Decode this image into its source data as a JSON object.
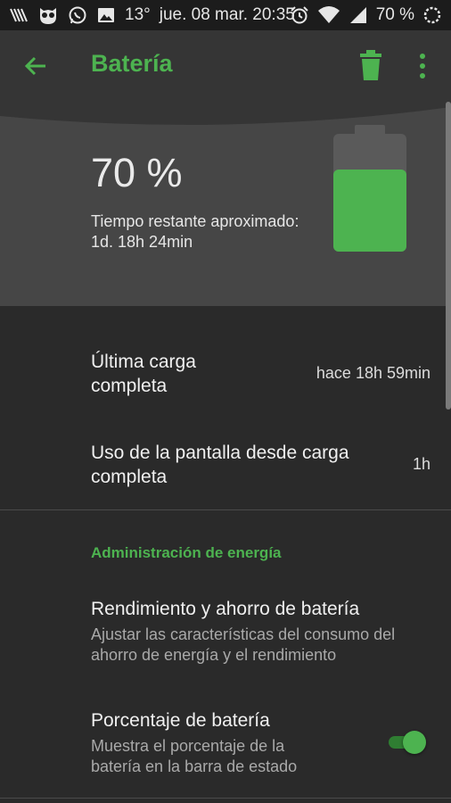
{
  "status_bar": {
    "left_icons": [
      "signal-slashes-icon",
      "owl-icon",
      "whatsapp-icon",
      "image-icon"
    ],
    "weather": "13°",
    "date_time": "jue. 08 mar. 20:35",
    "right_icons": [
      "alarm-icon",
      "wifi-icon",
      "cell-signal-icon"
    ],
    "battery_percent": "70 %"
  },
  "toolbar": {
    "title": "Batería",
    "accent_color": "#4db350"
  },
  "hero": {
    "percent": "70 %",
    "remaining_label": "Tiempo restante aproximado:",
    "remaining_value": "1d. 18h 24min",
    "battery_level": 0.7
  },
  "rows": [
    {
      "title_line1": "Última carga",
      "title_line2": "completa",
      "value": "hace 18h 59min"
    },
    {
      "title_line1": "Uso de la pantalla desde carga",
      "title_line2": "completa",
      "value": "1h"
    }
  ],
  "section_header": "Administración de energía",
  "settings": [
    {
      "title": "Rendimiento y ahorro de batería",
      "sub_line1": "Ajustar las características del consumo del",
      "sub_line2": "ahorro de energía y el rendimiento"
    },
    {
      "title": "Porcentaje de batería",
      "sub_line1": "Muestra el porcentaje de la",
      "sub_line2": "batería en la barra de estado",
      "toggle_on": true
    }
  ]
}
